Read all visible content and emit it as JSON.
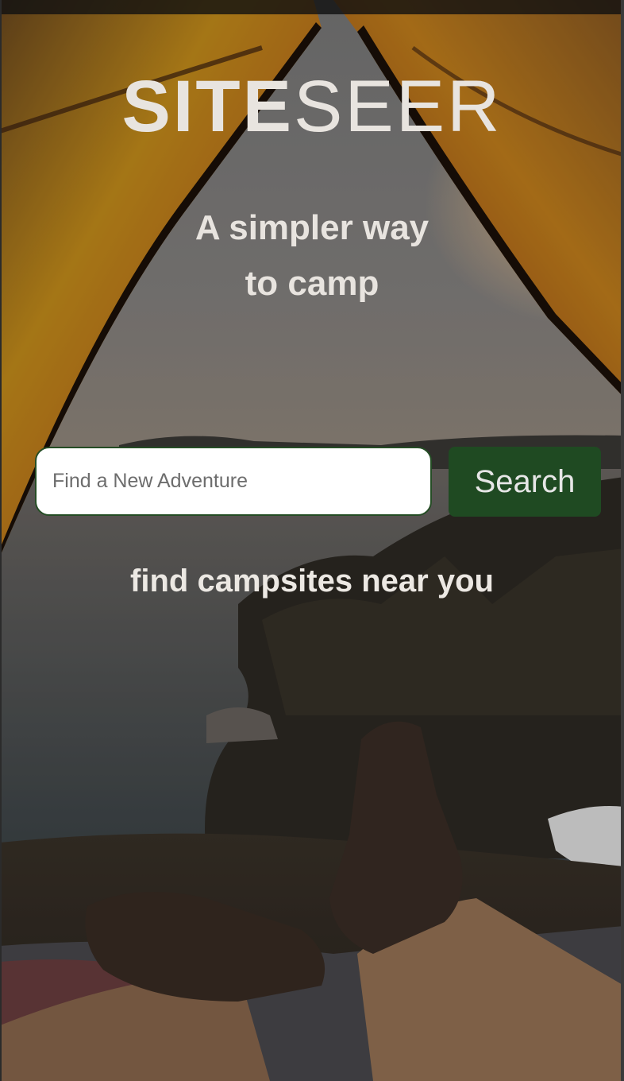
{
  "brand": {
    "logo_bold": "SITE",
    "logo_light": "SEER"
  },
  "hero": {
    "tagline_line1": "A simpler way",
    "tagline_line2": "to camp",
    "subtext": "find campsites near you"
  },
  "search": {
    "placeholder": "Find a New Adventure",
    "value": "",
    "button_label": "Search"
  },
  "colors": {
    "text": "#e8e4df",
    "button_bg": "#1f4a22",
    "input_border": "#254d25",
    "tent_fabric": "#c98a1e"
  }
}
